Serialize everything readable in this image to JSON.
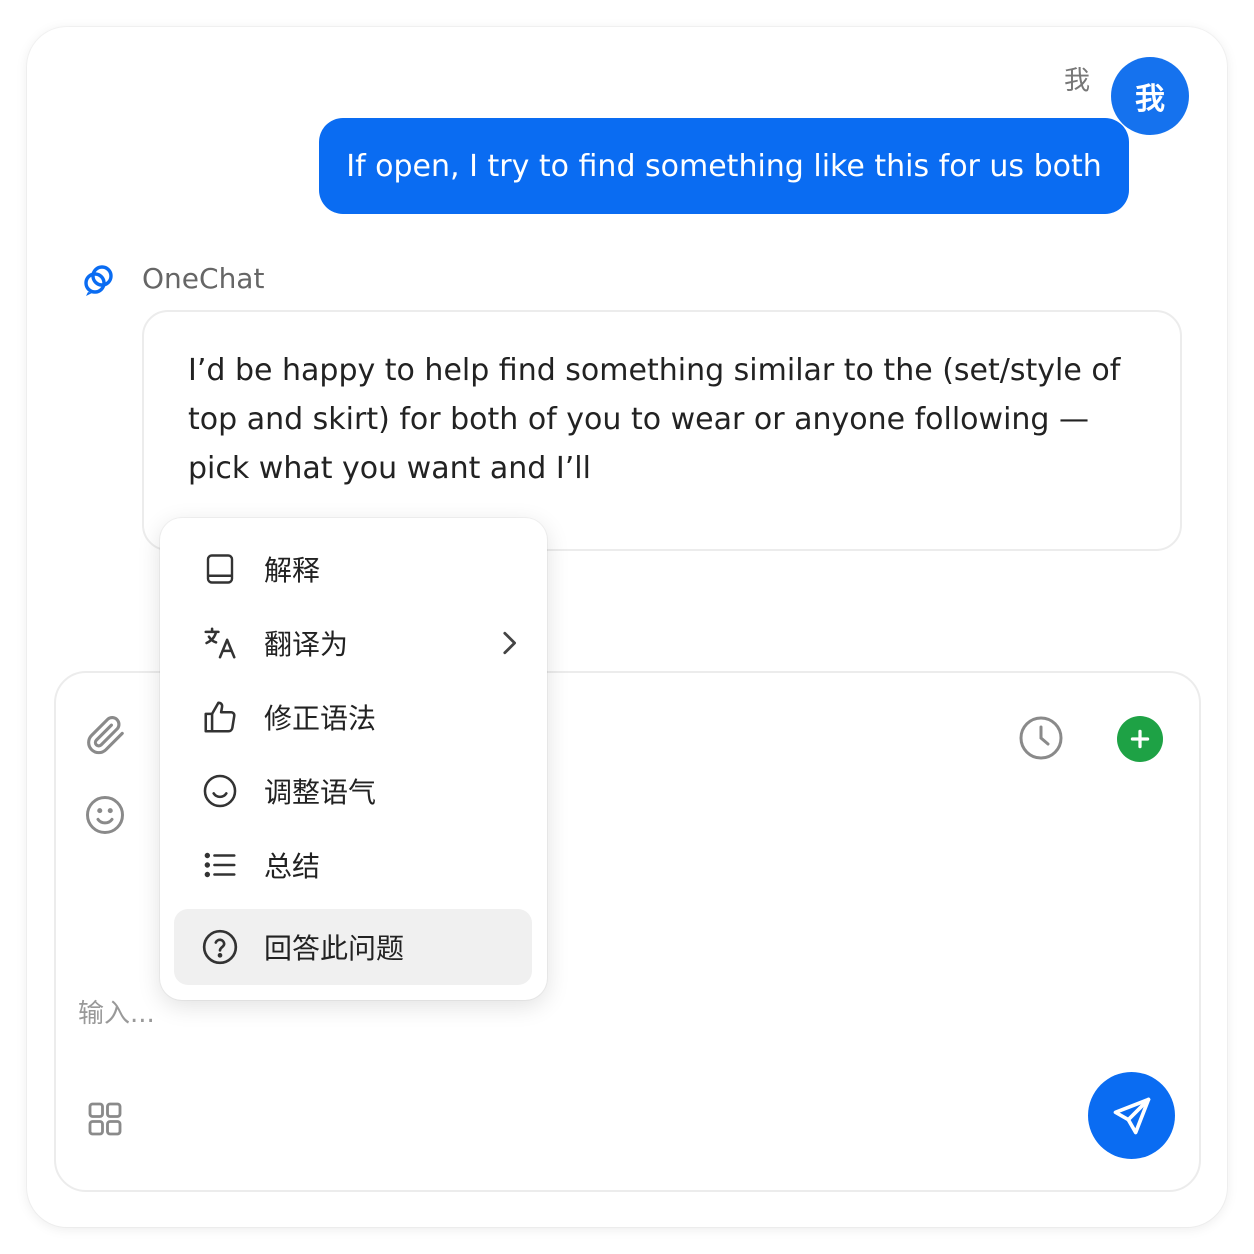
{
  "user": {
    "name": "我",
    "avatar_text": "我",
    "message": "If open, I try to find something like this for us both"
  },
  "bot": {
    "name": "OneChat",
    "logo_icon": "onechat-logo-icon",
    "message": "I’d be happy to help find something similar to the (set/style of top and skirt) for both of you to wear or anyone following — pick what you want and I’ll"
  },
  "context_menu": {
    "items": [
      {
        "label": "解释",
        "icon": "book-icon"
      },
      {
        "label": "翻译为",
        "icon": "translate-icon",
        "has_submenu": true
      },
      {
        "label": "修正语法",
        "icon": "thumbs-up-icon"
      },
      {
        "label": "调整语气",
        "icon": "smile-icon"
      },
      {
        "label": "总结",
        "icon": "list-icon"
      },
      {
        "label": "回答此问题",
        "icon": "question-circle-icon",
        "highlighted": true
      }
    ]
  },
  "composer": {
    "placeholder": "输入...",
    "icons": [
      "paperclip-icon",
      "emoji-icon",
      "grid-icon",
      "clock-icon",
      "plus-icon",
      "send-icon"
    ]
  },
  "colors": {
    "accent_blue": "#0a6cf2",
    "plus_green": "#1ea245",
    "menu_highlight": "#f0f0f0"
  }
}
